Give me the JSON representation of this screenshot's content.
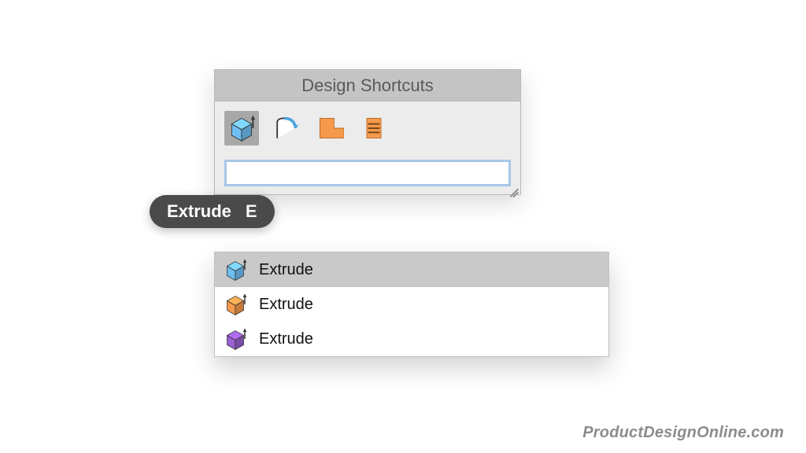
{
  "panel": {
    "title": "Design Shortcuts",
    "icons": [
      {
        "name": "extrude-icon",
        "kind": "cube-blue",
        "selected": true
      },
      {
        "name": "revolve-icon",
        "kind": "arc-outline",
        "selected": false
      },
      {
        "name": "sweep-icon",
        "kind": "l-shape-orange",
        "selected": false
      },
      {
        "name": "loft-icon",
        "kind": "stack-lines-orange",
        "selected": false
      }
    ],
    "search": {
      "value": "",
      "placeholder": ""
    }
  },
  "tooltip": {
    "label": "Extrude",
    "shortcut": "E"
  },
  "dropdown": {
    "items": [
      {
        "label": "Extrude",
        "icon_kind": "cube-blue",
        "highlighted": true
      },
      {
        "label": "Extrude",
        "icon_kind": "cube-orange",
        "highlighted": false
      },
      {
        "label": "Extrude",
        "icon_kind": "cube-purple",
        "highlighted": false
      }
    ]
  },
  "watermark": "ProductDesignOnline.com",
  "colors": {
    "blue": "#6fbef2",
    "orange": "#f59a4c",
    "purple": "#9a5fd0",
    "tooltip_bg": "#4a4a4a"
  }
}
